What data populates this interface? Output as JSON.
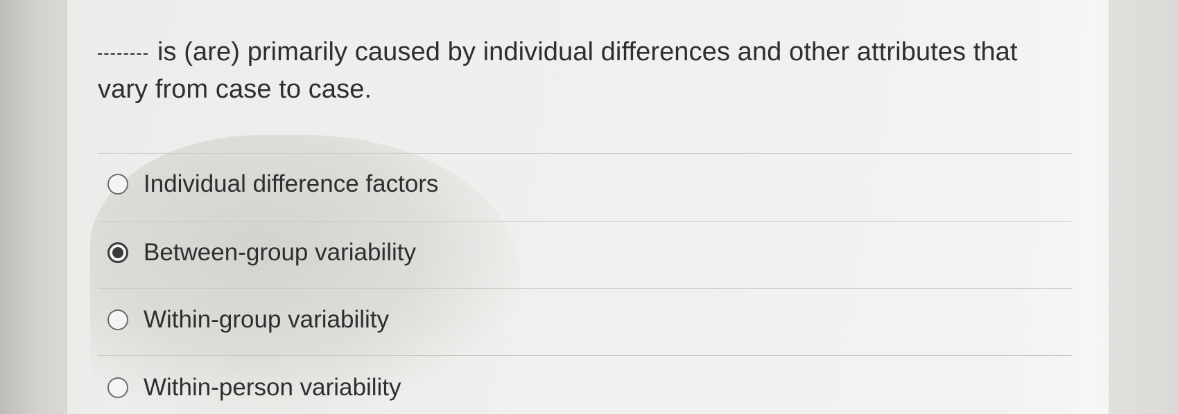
{
  "question": {
    "blank": "_____",
    "text": "is (are) primarily caused by individual differences and other attributes that vary from case to case."
  },
  "options": [
    {
      "label": "Individual difference factors",
      "selected": false
    },
    {
      "label": "Between-group variability",
      "selected": true
    },
    {
      "label": "Within-group variability",
      "selected": false
    },
    {
      "label": "Within-person variability",
      "selected": false
    }
  ]
}
